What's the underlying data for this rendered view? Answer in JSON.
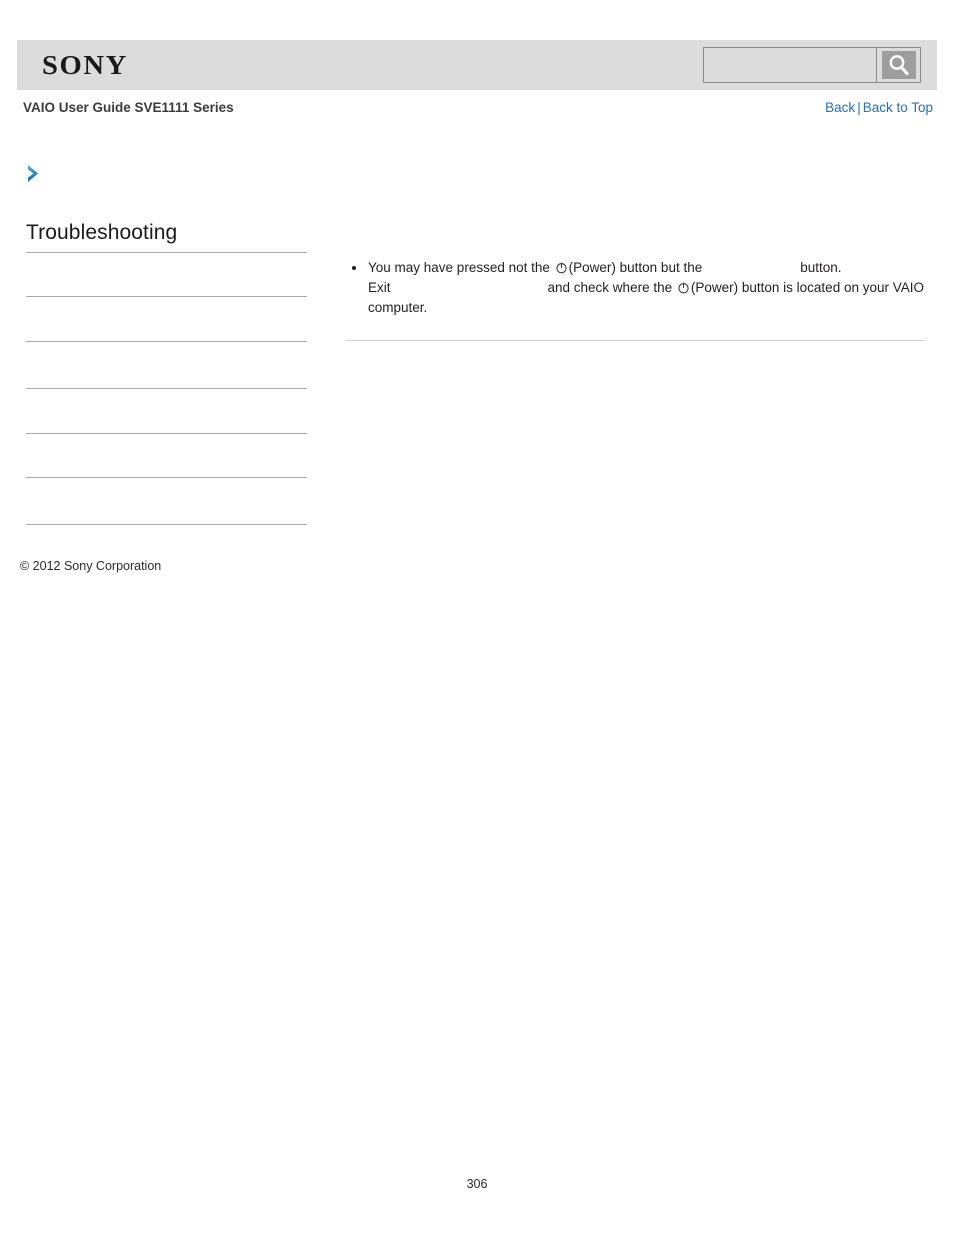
{
  "header": {
    "logo_text": "SONY",
    "logo_icon": "sony-wordmark",
    "search": {
      "value": "",
      "placeholder": "",
      "button_icon": "search-icon"
    }
  },
  "subheader": {
    "guide_title": "VAIO User Guide SVE1111 Series",
    "links": {
      "back": "Back",
      "separator": "|",
      "back_to_top": "Back to Top"
    }
  },
  "breadcrumb": {
    "icon": "chevron-right-icon",
    "text": ""
  },
  "sidebar": {
    "title": "Troubleshooting",
    "items": [
      {
        "label": ""
      },
      {
        "label": ""
      },
      {
        "label": ""
      },
      {
        "label": ""
      },
      {
        "label": ""
      },
      {
        "label": ""
      }
    ]
  },
  "content": {
    "bullets": [
      {
        "part1": "You may have pressed not the",
        "power_icon_1": "power-icon",
        "part2": "(Power) button but the",
        "missing_1": "",
        "part3": "button.",
        "part4": "Exit",
        "missing_2": "",
        "part5": "and check where the",
        "power_icon_2": "power-icon",
        "part6": "(Power) button is located on your VAIO computer."
      }
    ]
  },
  "footer": {
    "copyright": "© 2012 Sony Corporation",
    "page_number": "306"
  },
  "colors": {
    "header_bg": "#dcdcdc",
    "link_blue": "#1f6fc4",
    "chevron_blue": "#2e8bc9",
    "rule_gray": "#a8a8a8"
  }
}
